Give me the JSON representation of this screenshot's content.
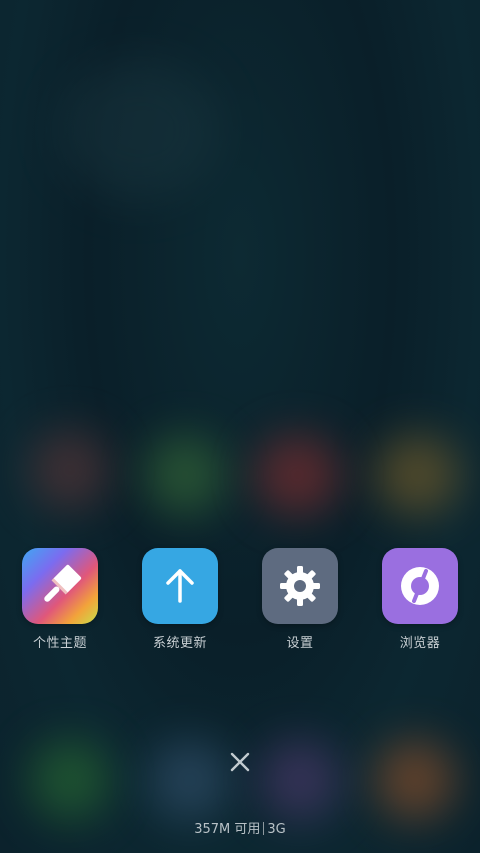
{
  "recent_apps": [
    {
      "label": "个性主题",
      "icon": "paintbrush-icon",
      "color": "#e0577a"
    },
    {
      "label": "系统更新",
      "icon": "arrow-up-icon",
      "color": "#36a7e3"
    },
    {
      "label": "设置",
      "icon": "gear-icon",
      "color": "#5e6b80"
    },
    {
      "label": "浏览器",
      "icon": "browser-icon",
      "color": "#9a6fe0"
    }
  ],
  "close_button": {
    "icon": "close-icon"
  },
  "memory_status": {
    "available": "357M 可用",
    "network": "3G"
  }
}
